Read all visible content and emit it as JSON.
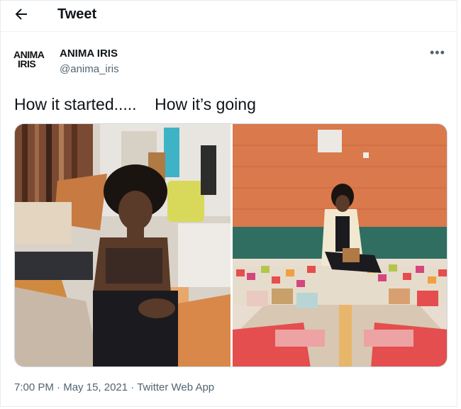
{
  "header": {
    "title": "Tweet",
    "back_icon": "arrow-left-icon"
  },
  "author": {
    "logo_text_1": "ANIMA",
    "logo_text_2": "IRIS",
    "display_name": "ANIMA IRIS",
    "handle": "@anima_iris",
    "more_icon": "more-horizontal-icon"
  },
  "tweet": {
    "text": "How it started.....    How it’s going"
  },
  "media": {
    "left_alt": "",
    "right_alt": ""
  },
  "meta": {
    "time": "7:00 PM",
    "sep1": " · ",
    "date": "May 15, 2021",
    "sep2": " · ",
    "source": "Twitter Web App"
  }
}
